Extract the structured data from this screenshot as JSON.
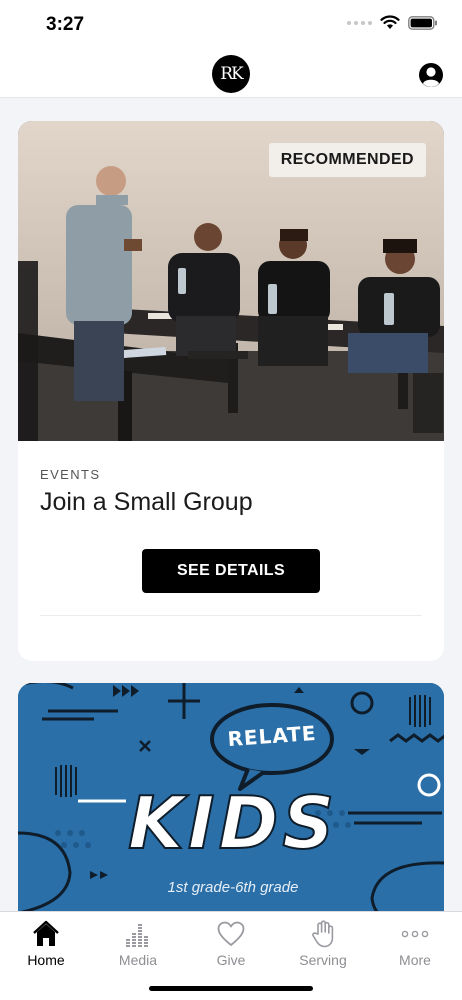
{
  "status_bar": {
    "time": "3:27"
  },
  "header": {
    "logo_text": "RK",
    "profile_icon": "person-circle-icon"
  },
  "featured_card": {
    "badge": "RECOMMENDED",
    "category": "EVENTS",
    "title": "Join a Small Group",
    "button_label": "SEE DETAILS"
  },
  "kids_card": {
    "bubble_text": "RELATE",
    "title": "KIDS",
    "subtitle": "1st grade-6th grade"
  },
  "tabs": [
    {
      "label": "Home",
      "icon": "home-icon",
      "active": true
    },
    {
      "label": "Media",
      "icon": "equalizer-icon",
      "active": false
    },
    {
      "label": "Give",
      "icon": "heart-icon",
      "active": false
    },
    {
      "label": "Serving",
      "icon": "hand-icon",
      "active": false
    },
    {
      "label": "More",
      "icon": "more-dots-icon",
      "active": false
    }
  ],
  "colors": {
    "kids_bg": "#2a6fa8",
    "accent": "#000000",
    "inactive": "#8e8e93"
  }
}
